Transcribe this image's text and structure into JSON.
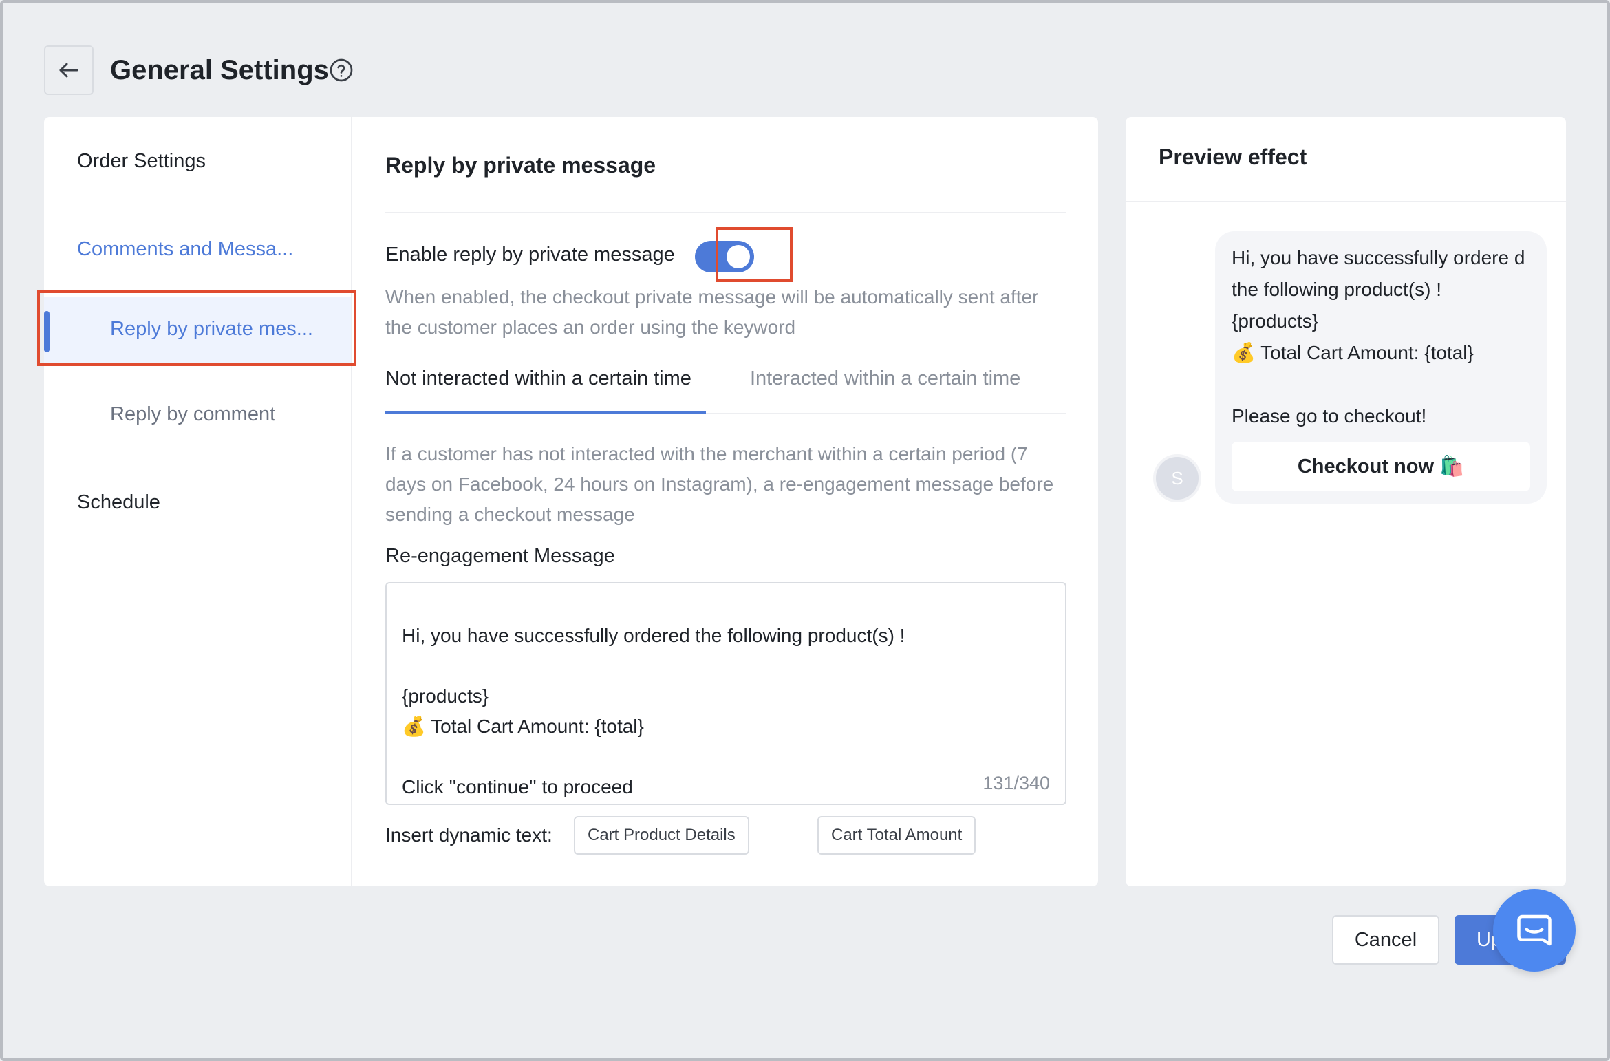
{
  "header": {
    "title": "General Settings"
  },
  "sidebar": {
    "items": [
      {
        "label": "Order Settings"
      },
      {
        "label": "Comments and Messa..."
      },
      {
        "label": "Reply by private mes..."
      },
      {
        "label": "Reply by comment"
      },
      {
        "label": "Schedule"
      }
    ]
  },
  "main": {
    "section_title": "Reply by private message",
    "enable_label": "Enable reply by private message",
    "enabled": true,
    "enable_description": "When enabled, the checkout private message will be automatically sent after the customer places an order using the keyword",
    "tabs": [
      {
        "label": "Not interacted within a certain time",
        "active": true
      },
      {
        "label": "Interacted within a certain time",
        "active": false
      }
    ],
    "info_text": "If a customer has not interacted with the merchant within a certain period (7 days on Facebook, 24 hours on Instagram), a re-engagement message before sending a checkout message",
    "reengagement_label": "Re-engagement Message",
    "message_value": "Hi, you have successfully ordered the following product(s) !\n\n{products}\n💰 Total Cart Amount: {total}\n\nClick ''continue'' to proceed",
    "counter": "131/340",
    "insert_label": "Insert dynamic text:",
    "chips": [
      "Cart Product Details",
      "Cart Total Amount"
    ]
  },
  "preview": {
    "title": "Preview effect",
    "bubble_text": "Hi, you have successfully ordere d the following product(s) !\n{products}\n💰 Total Cart Amount: {total}\n\nPlease go to checkout!",
    "checkout_label": "Checkout now 🛍️",
    "avatar_initial": "S"
  },
  "footer": {
    "cancel_label": "Cancel",
    "update_label": "Update"
  },
  "colors": {
    "accent": "#4d7ad8",
    "highlight": "#e04b2f",
    "background": "#eceef1"
  },
  "icons": {
    "back": "arrow-left-icon",
    "help": "question-circle-icon",
    "chat": "chat-icon"
  }
}
